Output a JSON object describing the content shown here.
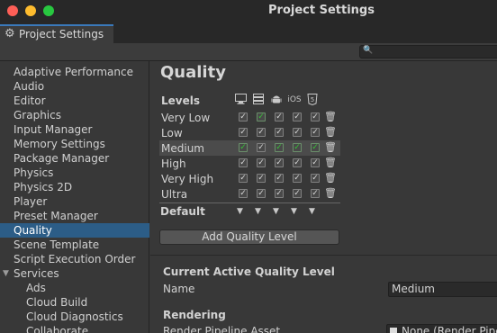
{
  "window": {
    "title": "Project Settings"
  },
  "tab": {
    "label": "Project Settings",
    "icon": "gear-icon"
  },
  "search": {
    "placeholder": "",
    "icon": "search-icon"
  },
  "sidebar": {
    "items": [
      {
        "label": "Adaptive Performance"
      },
      {
        "label": "Audio"
      },
      {
        "label": "Editor"
      },
      {
        "label": "Graphics"
      },
      {
        "label": "Input Manager"
      },
      {
        "label": "Memory Settings"
      },
      {
        "label": "Package Manager"
      },
      {
        "label": "Physics"
      },
      {
        "label": "Physics 2D"
      },
      {
        "label": "Player"
      },
      {
        "label": "Preset Manager"
      },
      {
        "label": "Quality",
        "selected": true
      },
      {
        "label": "Scene Template"
      },
      {
        "label": "Script Execution Order"
      },
      {
        "label": "Services",
        "expanded": true
      },
      {
        "label": "Ads",
        "child": true
      },
      {
        "label": "Cloud Build",
        "child": true
      },
      {
        "label": "Cloud Diagnostics",
        "child": true
      },
      {
        "label": "Collaborate",
        "child": true
      }
    ]
  },
  "main": {
    "title": "Quality",
    "levels_header": "Levels",
    "platform_icons": [
      "monitor-icon",
      "server-icon",
      "android-icon",
      "ios-icon",
      "html5-icon"
    ],
    "ios_label": "iOS",
    "html5_label": "5",
    "levels": [
      {
        "name": "Very Low",
        "checks": [
          "white",
          "green",
          "white",
          "white",
          "white"
        ]
      },
      {
        "name": "Low",
        "checks": [
          "white",
          "white",
          "white",
          "white",
          "white"
        ]
      },
      {
        "name": "Medium",
        "active": true,
        "checks": [
          "green",
          "white",
          "green",
          "green",
          "green"
        ]
      },
      {
        "name": "High",
        "checks": [
          "white",
          "white",
          "white",
          "white",
          "white"
        ]
      },
      {
        "name": "Very High",
        "checks": [
          "white",
          "white",
          "white",
          "white",
          "white"
        ]
      },
      {
        "name": "Ultra",
        "checks": [
          "white",
          "white",
          "white",
          "white",
          "white"
        ]
      }
    ],
    "default_label": "Default",
    "add_button": "Add Quality Level",
    "current_section": "Current Active Quality Level",
    "name_label": "Name",
    "name_value": "Medium",
    "rendering_section": "Rendering",
    "pipeline_label": "Render Pipeline Asset",
    "pipeline_value": "None (Render Pipeline Asset)"
  },
  "colors": {
    "selection": "#2c5d87",
    "check_green": "#36c236",
    "tab_accent": "#3a79bb"
  }
}
